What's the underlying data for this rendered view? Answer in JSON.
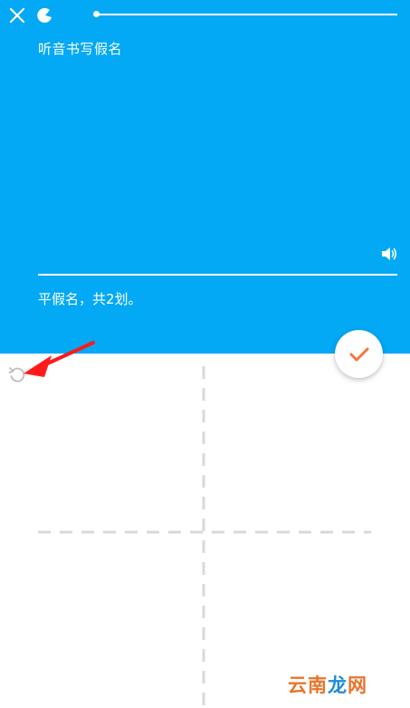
{
  "header": {
    "close_icon": "close-icon",
    "mascot_icon": "mascot-icon",
    "progress_fraction": 0.0
  },
  "question": {
    "title": "听音书写假名",
    "speaker_icon": "speaker-icon",
    "hint": "平假名，共2划。"
  },
  "actions": {
    "submit_icon": "checkmark-icon",
    "undo_icon": "undo-icon"
  },
  "annotation": {
    "arrow_color": "#ff1a1a"
  },
  "watermark": {
    "part1": "云南",
    "part2": "龙",
    "part3": "网"
  },
  "colors": {
    "accent": "#03a9f4",
    "check": "#f5753b"
  }
}
